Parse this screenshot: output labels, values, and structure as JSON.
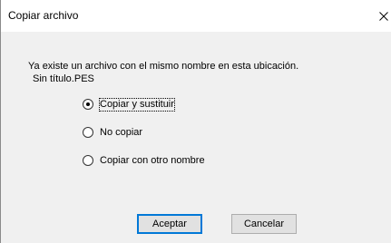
{
  "window": {
    "title": "Copiar archivo"
  },
  "dialog": {
    "message": "Ya existe un archivo con el mismo nombre en esta ubicación.",
    "filename": "Sin título.PES"
  },
  "options": [
    {
      "label": "Copiar y sustituir",
      "selected": true
    },
    {
      "label": "No copiar",
      "selected": false
    },
    {
      "label": "Copiar con otro nombre",
      "selected": false
    }
  ],
  "buttons": {
    "accept_label": "Aceptar",
    "cancel_label": "Cancelar"
  },
  "icons": {
    "close": "close-icon"
  },
  "colors": {
    "titlebar": "#ffffff",
    "client": "#f0f0f0",
    "default_button_border": "#0078d7"
  }
}
